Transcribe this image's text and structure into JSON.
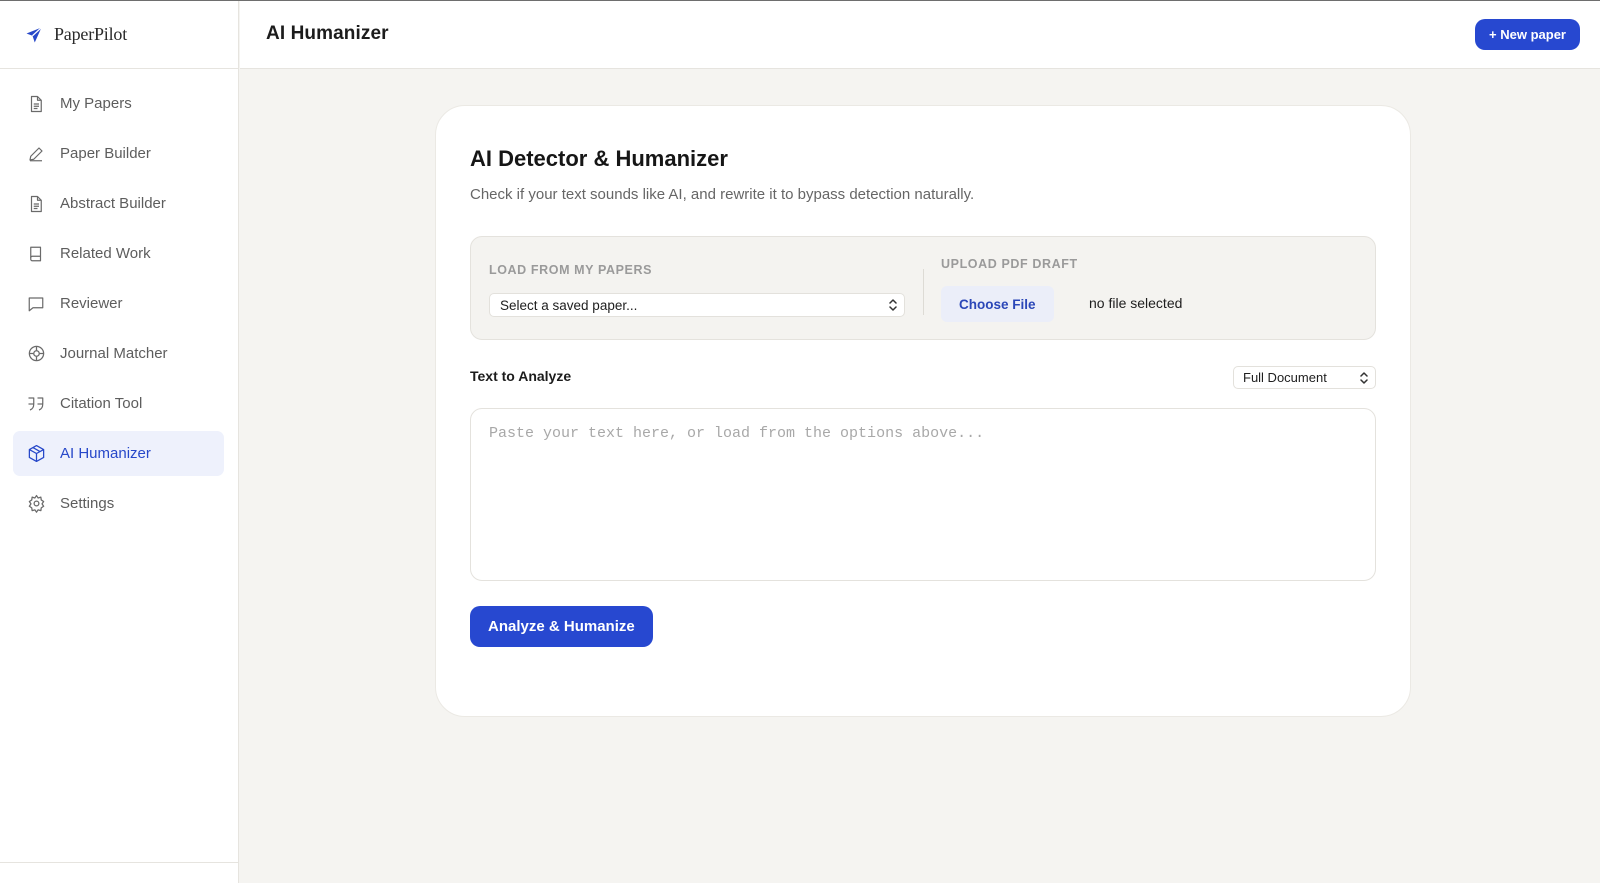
{
  "brand": {
    "name": "PaperPilot",
    "icon": "paper-plane-icon"
  },
  "header": {
    "title": "AI Humanizer",
    "new_paper_label": "+ New paper"
  },
  "sidebar": {
    "items": [
      {
        "label": "My Papers",
        "icon": "document-icon",
        "active": false
      },
      {
        "label": "Paper Builder",
        "icon": "pencil-icon",
        "active": false
      },
      {
        "label": "Abstract Builder",
        "icon": "document-icon",
        "active": false
      },
      {
        "label": "Related Work",
        "icon": "book-icon",
        "active": false
      },
      {
        "label": "Reviewer",
        "icon": "chat-bubble-icon",
        "active": false
      },
      {
        "label": "Journal Matcher",
        "icon": "target-icon",
        "active": false
      },
      {
        "label": "Citation Tool",
        "icon": "quote-icon",
        "active": false
      },
      {
        "label": "AI Humanizer",
        "icon": "cube-icon",
        "active": true
      },
      {
        "label": "Settings",
        "icon": "gear-icon",
        "active": false
      }
    ]
  },
  "card": {
    "title": "AI Detector & Humanizer",
    "subtitle": "Check if your text sounds like AI, and rewrite it to bypass detection naturally.",
    "load_label": "LOAD FROM MY PAPERS",
    "saved_select_value": "Select a saved paper...",
    "upload_label": "UPLOAD PDF DRAFT",
    "choose_file_label": "Choose File",
    "file_status": "no file selected",
    "text_label": "Text to Analyze",
    "scope_value": "Full Document",
    "textarea_placeholder": "Paste your text here, or load from the options above...",
    "analyze_label": "Analyze & Humanize"
  },
  "colors": {
    "accent": "#2748d0",
    "active_nav_bg": "#eef1fc",
    "page_bg": "#f5f4f1"
  }
}
